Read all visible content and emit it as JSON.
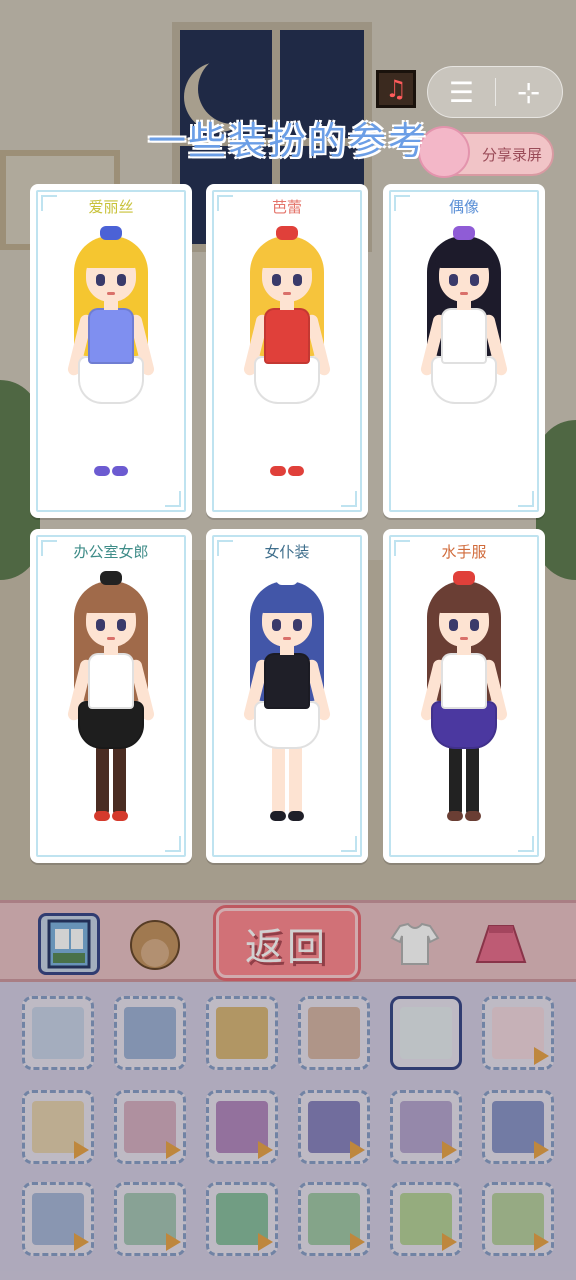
{
  "heading": "一些装扮的参考",
  "top_controls": {
    "music_icon": "music-note-icon",
    "menu_icon": "hamburger-menu-icon",
    "close_icon": "target-close-icon",
    "share_label": "分享录屏"
  },
  "cards": [
    {
      "title": "爱丽丝",
      "title_color": "#c8c23a",
      "hair": "#f5c630",
      "outfit": "#7f8ff0",
      "skirt": "#ffffff",
      "legs": "#ffffff",
      "shoes": "#6c5bd1",
      "accent": "#4b62d6"
    },
    {
      "title": "芭蕾",
      "title_color": "#e4756b",
      "hair": "#f6c43c",
      "outfit": "#e0403a",
      "skirt": "#ffffff",
      "legs": "#ffffff",
      "shoes": "#e0403a",
      "accent": "#e0403a"
    },
    {
      "title": "偶像",
      "title_color": "#5a8fd6",
      "hair": "#1d1b2b",
      "outfit": "#ffffff",
      "skirt": "#ffffff",
      "legs": "#ffffff",
      "shoes": "#ffffff",
      "accent": "#8f5cd6"
    },
    {
      "title": "办公室女郎",
      "title_color": "#3e8c88",
      "hair": "#a06a4a",
      "outfit": "#ffffff",
      "skirt": "#1e1e1e",
      "legs": "#4a2c22",
      "shoes": "#d43a2c",
      "accent": "#222222"
    },
    {
      "title": "女仆装",
      "title_color": "#3e6e8c",
      "hair": "#4256a8",
      "outfit": "#1f1f28",
      "skirt": "#ffffff",
      "legs": "#fde3d2",
      "shoes": "#1f1f28",
      "accent": "#ffffff"
    },
    {
      "title": "水手服",
      "title_color": "#d06a3a",
      "hair": "#6a3e34",
      "outfit": "#ffffff",
      "skirt": "#4b38a0",
      "legs": "#222222",
      "shoes": "#6a3e34",
      "accent": "#e0403a"
    }
  ],
  "toolbar": {
    "return_label": "返回",
    "tools": [
      "background-icon",
      "hair-icon",
      "top-icon",
      "skirt-icon"
    ]
  },
  "grid": {
    "rows": [
      [
        {
          "color": "#c8d4e8",
          "play": false
        },
        {
          "color": "#9fb2d6",
          "play": false
        },
        {
          "color": "#d8b77a",
          "play": false
        },
        {
          "color": "#d6b6a6",
          "play": false
        },
        {
          "color": "#e6ecf0",
          "play": false,
          "selected": true
        },
        {
          "color": "#f2d8e0",
          "play": true
        }
      ],
      [
        {
          "color": "#e6d2b0",
          "play": true
        },
        {
          "color": "#d6b0c2",
          "play": true
        },
        {
          "color": "#b48ac0",
          "play": true
        },
        {
          "color": "#8a86c0",
          "play": true
        },
        {
          "color": "#b6a6d0",
          "play": true
        },
        {
          "color": "#8c96c8",
          "play": true
        }
      ],
      [
        {
          "color": "#a8b8d8",
          "play": true
        },
        {
          "color": "#a6c6b6",
          "play": true
        },
        {
          "color": "#8ac0a0",
          "play": true
        },
        {
          "color": "#a2c8a8",
          "play": true
        },
        {
          "color": "#b6d29a",
          "play": true
        },
        {
          "color": "#b8d0a0",
          "play": true
        }
      ]
    ]
  }
}
